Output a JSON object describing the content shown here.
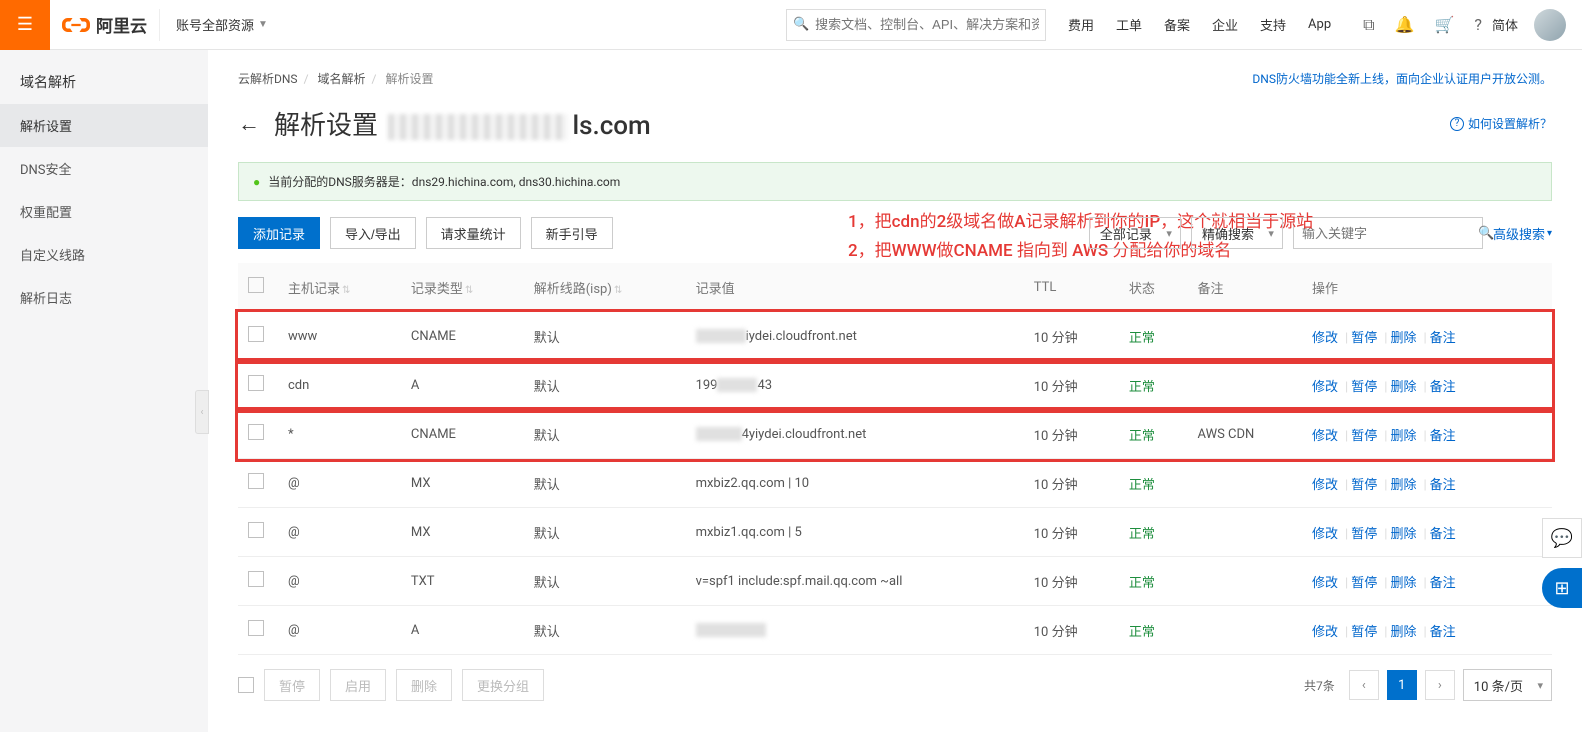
{
  "topbar": {
    "brand": "阿里云",
    "account_dd": "账号全部资源",
    "search_placeholder": "搜索文档、控制台、API、解决方案和资",
    "nav": [
      "费用",
      "工单",
      "备案",
      "企业",
      "支持",
      "App"
    ],
    "lang": "简体"
  },
  "sidebar": {
    "items": [
      {
        "label": "域名解析",
        "active": false,
        "head": true
      },
      {
        "label": "解析设置",
        "active": true
      },
      {
        "label": "DNS安全",
        "active": false
      },
      {
        "label": "权重配置",
        "active": false
      },
      {
        "label": "自定义线路",
        "active": false
      },
      {
        "label": "解析日志",
        "active": false
      }
    ]
  },
  "crumbs": {
    "a": "云解析DNS",
    "b": "域名解析",
    "c": "解析设置"
  },
  "announce": "DNS防火墙功能全新上线，面向企业认证用户开放公测。",
  "title": {
    "prefix": "解析设置",
    "suffix": "ls.com"
  },
  "help": "如何设置解析？",
  "alert": "当前分配的DNS服务器是：dns29.hichina.com, dns30.hichina.com",
  "annot": {
    "l1": "1，把cdn的2级域名做A记录解析到你的IP，这个就相当于源站",
    "l2": "2，把WWW做CNAME 指向到 AWS 分配给你的域名"
  },
  "toolbar": {
    "add": "添加记录",
    "impexp": "导入/导出",
    "stats": "请求量统计",
    "guide": "新手引导",
    "allrec": "全部记录",
    "exact": "精确搜索",
    "kw_placeholder": "输入关键字",
    "adv": "高级搜索"
  },
  "columns": {
    "host": "主机记录",
    "type": "记录类型",
    "line": "解析线路(isp)",
    "value": "记录值",
    "ttl": "TTL",
    "status": "状态",
    "remark": "备注",
    "ops": "操作"
  },
  "rows": [
    {
      "host": "www",
      "type": "CNAME",
      "line": "默认",
      "value_blur": 50,
      "value_tail": "iydei.cloudfront.net",
      "ttl": "10 分钟",
      "status": "正常",
      "remark": "",
      "boxed": true
    },
    {
      "host": "cdn",
      "type": "A",
      "line": "默认",
      "value_pre": "199",
      "value_blur": 40,
      "value_tail": "43",
      "ttl": "10 分钟",
      "status": "正常",
      "remark": "",
      "boxed": true
    },
    {
      "host": "*",
      "type": "CNAME",
      "line": "默认",
      "value_blur": 46,
      "value_tail": "4yiydei.cloudfront.net",
      "ttl": "10 分钟",
      "status": "正常",
      "remark": "AWS CDN",
      "boxed": true
    },
    {
      "host": "@",
      "type": "MX",
      "line": "默认",
      "value": "mxbiz2.qq.com | 10",
      "ttl": "10 分钟",
      "status": "正常",
      "remark": ""
    },
    {
      "host": "@",
      "type": "MX",
      "line": "默认",
      "value": "mxbiz1.qq.com | 5",
      "ttl": "10 分钟",
      "status": "正常",
      "remark": ""
    },
    {
      "host": "@",
      "type": "TXT",
      "line": "默认",
      "value": "v=spf1 include:spf.mail.qq.com ~all",
      "ttl": "10 分钟",
      "status": "正常",
      "remark": ""
    },
    {
      "host": "@",
      "type": "A",
      "line": "默认",
      "value_blur": 70,
      "value_tail": "",
      "ttl": "10 分钟",
      "status": "正常",
      "remark": ""
    }
  ],
  "ops": {
    "edit": "修改",
    "pause": "暂停",
    "delete": "删除",
    "remark": "备注"
  },
  "footer": {
    "pause": "暂停",
    "enable": "启用",
    "delete": "删除",
    "regroup": "更换分组",
    "total": "共7条",
    "page": "1",
    "size": "10 条/页"
  }
}
